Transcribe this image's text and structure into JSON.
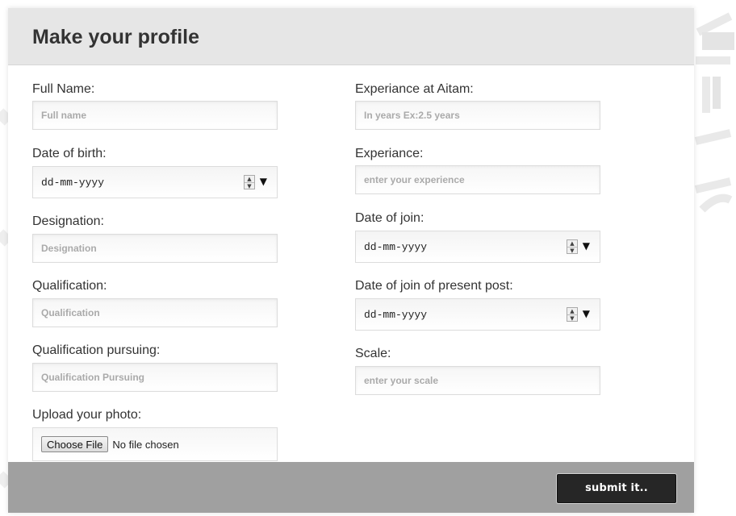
{
  "form": {
    "title": "Make your profile",
    "left_fields": [
      {
        "label": "Full Name:",
        "placeholder": "Full name"
      },
      {
        "label": "Date of birth:",
        "value": "dd-mm-yyyy"
      },
      {
        "label": "Designation:",
        "placeholder": "Designation"
      },
      {
        "label": "Qualification:",
        "placeholder": "Qualification"
      },
      {
        "label": "Qualification pursuing:",
        "placeholder": "Qualification Pursuing"
      },
      {
        "label": "Upload your photo:",
        "button": "Choose File",
        "status": "No file chosen"
      }
    ],
    "right_fields": [
      {
        "label": "Experiance at Aitam:",
        "placeholder": "In years Ex:2.5 years"
      },
      {
        "label": "Experiance:",
        "placeholder": "enter your experience"
      },
      {
        "label": "Date of join:",
        "value": "dd-mm-yyyy"
      },
      {
        "label": "Date of join of present post:",
        "value": "dd-mm-yyyy"
      },
      {
        "label": "Scale:",
        "placeholder": "enter your scale"
      }
    ],
    "submit_label": "submit it..",
    "spinner_up": "▲",
    "spinner_down": "▼",
    "dropdown_arrow": "▼"
  },
  "icons": {
    "spinner": "spin-up-down-icon",
    "dropdown": "chevron-down-icon"
  },
  "colors": {
    "header_bg": "#e6e6e6",
    "footer_bg": "#a0a0a0",
    "submit_bg": "#262626",
    "placeholder": "#aaaaaa"
  }
}
